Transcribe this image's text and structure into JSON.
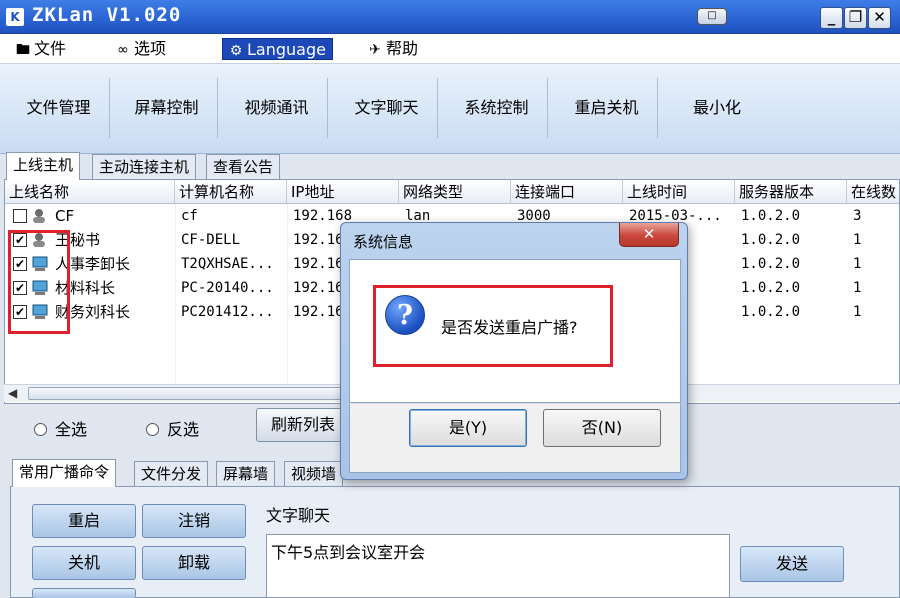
{
  "window": {
    "title": "ZKLan V1.020",
    "icon_letter": "K",
    "restore_small": "□",
    "controls": {
      "minimize": "_",
      "maximize": "❐",
      "close": "✕"
    }
  },
  "menu": {
    "file": "文件",
    "options": "选项",
    "language": "Language",
    "help": "帮助"
  },
  "toolbar": {
    "buttons": [
      "文件管理",
      "屏幕控制",
      "视频通讯",
      "文字聊天",
      "系统控制",
      "重启关机",
      "最小化"
    ]
  },
  "tabs": [
    "上线主机",
    "主动连接主机",
    "查看公告"
  ],
  "list": {
    "columns": [
      "上线名称",
      "计算机名称",
      "IP地址",
      "网络类型",
      "连接端口",
      "上线时间",
      "服务器版本",
      "在线数"
    ],
    "rows": [
      {
        "checked": false,
        "name": "CF",
        "computer": "cf",
        "ip": "192.168",
        "net": "lan",
        "port": "3000",
        "time": "2015-03-...",
        "version": "1.0.2.0",
        "online": "3"
      },
      {
        "checked": true,
        "name": "王秘书",
        "computer": "CF-DELL",
        "ip": "192.16",
        "net": "",
        "port": "",
        "time": "",
        "version": "1.0.2.0",
        "online": "1"
      },
      {
        "checked": true,
        "name": "人事李卸长",
        "computer": "T2QXHSAE...",
        "ip": "192.16",
        "net": "",
        "port": "",
        "time": "",
        "version": "1.0.2.0",
        "online": "1"
      },
      {
        "checked": true,
        "name": "材料科长",
        "computer": "PC-20140...",
        "ip": "192.16",
        "net": "",
        "port": "",
        "time": "",
        "version": "1.0.2.0",
        "online": "1"
      },
      {
        "checked": true,
        "name": "财务刘科长",
        "computer": "PC201412...",
        "ip": "192.16",
        "net": "",
        "port": "",
        "time": "",
        "version": "1.0.2.0",
        "online": "1"
      }
    ]
  },
  "selection": {
    "select_all": "全选",
    "invert": "反选",
    "refresh": "刷新列表"
  },
  "bottom_tabs": [
    "常用广播命令",
    "文件分发",
    "屏幕墙",
    "视频墙"
  ],
  "commands": {
    "restart": "重启",
    "logout": "注销",
    "shutdown": "关机",
    "uninstall": "卸载"
  },
  "chat": {
    "label": "文字聊天",
    "message": "下午5点到会议室开会",
    "send": "发送"
  },
  "dialog": {
    "title": "系统信息",
    "close": "✕",
    "icon": "?",
    "message": "是否发送重启广播?",
    "yes": "是(Y)",
    "no": "否(N)"
  },
  "colors": {
    "titlebar": "#2a63d2",
    "highlight_box": "#e0202a",
    "dialog_frame": "#a9c3e6"
  }
}
